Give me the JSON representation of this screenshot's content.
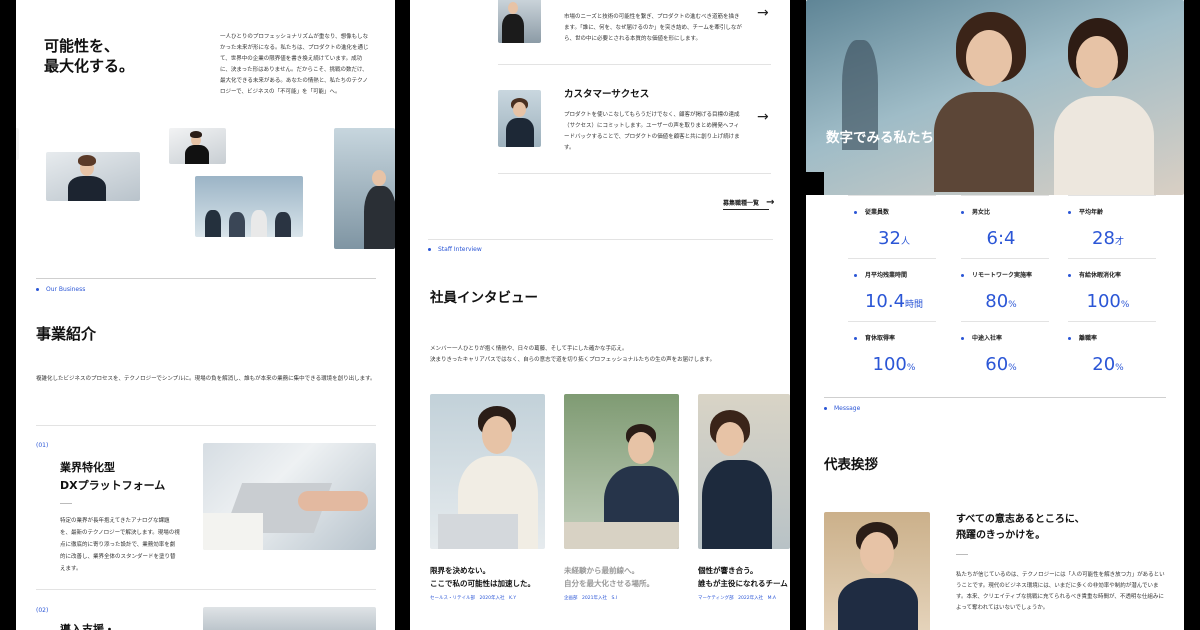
{
  "panel1": {
    "hero_title_line1": "可能性を、",
    "hero_title_line2": "最大化する。",
    "hero_text": "一人ひとりのプロフェッショナリズムが重なり、想像もしなかった未来が形になる。私たちは、プロダクトの進化を通じて、世界中の企業の限界値を書き換え続けています。成功に、決まった形はありません。だからこそ、挑戦の数だけ、最大化できる未来がある。あなたの情熱と、私たちのテクノロジーで、ビジネスの「不可能」を「可能」へ。",
    "business_label": "Our Business",
    "business_title": "事業紹介",
    "business_text": "複雑化したビジネスのプロセスを、テクノロジーでシンプルに。現場の負を解消し、誰もが本来の業務に集中できる環境を創り出します。",
    "item1_num": "(01)",
    "item1_title_line1": "業界特化型",
    "item1_title_line2": "DXプラットフォーム",
    "item1_text": "特定の業界が長年抱えてきたアナログな課題を、最新のテクノロジーで解決します。現場の視点に徹底的に寄り添った設計で、業務効率を劇的に改善し、業界全体のスタンダードを塗り替えます。",
    "item2_num": "(02)",
    "item2_title": "導入支援・"
  },
  "panel2": {
    "job_top_text": "市場のニーズと技術の可能性を繋ぎ、プロダクトの進むべき道筋を描きます。「誰に、何を、なぜ届けるのか」を突き詰め、チームを牽引しながら、世の中に必要とされる本質的な価値を形にします。",
    "job_title": "カスタマーサクセス",
    "job_text": "プロダクトを使いこなしてもらうだけでなく、顧客が掲げる目標の達成（サクセス）にコミットします。ユーザーの声を取りまとめ開発へフィードバックすることで、プロダクトの価値を顧客と共に創り上げ続けます。",
    "job_list_link": "募集職種一覧",
    "interview_label": "Staff Interview",
    "interview_title": "社員インタビュー",
    "interview_text_line1": "メンバー一人ひとりが抱く情熱や、日々の葛藤、そして手にした確かな手応え。",
    "interview_text_line2": "決まりきったキャリアパスではなく、自らの意志で道を切り拓くプロフェッショナルたちの生の声をお届けします。",
    "cards": [
      {
        "title_line1": "限界を決めない。",
        "title_line2": "ここで私の可能性は加速した。",
        "meta": "セールス・リテイル部　2020年入社　K.Y",
        "muted": false
      },
      {
        "title_line1": "未経験から最前線へ。",
        "title_line2": "自分を最大化させる場所。",
        "meta": "企画部　2021年入社　S.I",
        "muted": true
      },
      {
        "title_line1": "個性が響き合う。",
        "title_line2": "誰もが主役になれるチーム",
        "meta": "マーケティング部　2022年入社　M.A",
        "muted": false
      }
    ]
  },
  "panel3": {
    "numbers_title": "数字でみる私たち",
    "stats": [
      {
        "label": "従業員数",
        "value": "32",
        "unit": "人"
      },
      {
        "label": "男女比",
        "value": "6:4",
        "unit": ""
      },
      {
        "label": "平均年齢",
        "value": "28",
        "unit": "才"
      },
      {
        "label": "月平均残業時間",
        "value": "10.4",
        "unit": "時間"
      },
      {
        "label": "リモートワーク実施率",
        "value": "80",
        "unit": "%"
      },
      {
        "label": "有給休暇消化率",
        "value": "100",
        "unit": "%"
      },
      {
        "label": "育休取得率",
        "value": "100",
        "unit": "%"
      },
      {
        "label": "中途入社率",
        "value": "60",
        "unit": "%"
      },
      {
        "label": "離職率",
        "value": "20",
        "unit": "%"
      }
    ],
    "message_label": "Message",
    "message_title": "代表挨拶",
    "greeting_line1": "すべての意志あるところに、",
    "greeting_line2": "飛躍のきっかけを。",
    "greeting_text": "私たちが信じているのは、テクノロジーには「人の可能性を解き放つ力」があるということです。現代のビジネス環境には、いまだに多くの非効率や制約が潜んでいます。本来、クリエイティブな挑戦に充てられるべき貴重な時間が、不透明な仕組みによって奪われてはいないでしょうか。"
  },
  "colors": {
    "accent": "#2b56d6",
    "background": "#000000",
    "panel": "#ffffff"
  }
}
